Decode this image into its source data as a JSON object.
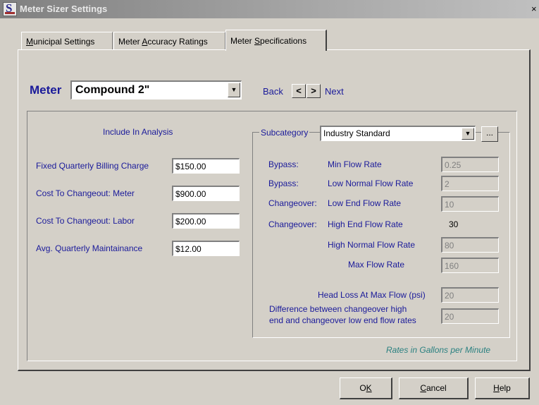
{
  "window": {
    "title": "Meter Sizer Settings",
    "close_glyph": "×"
  },
  "tabs": [
    {
      "label_pre": "",
      "label_u": "M",
      "label_post": "unicipal Settings",
      "active": false
    },
    {
      "label_pre": "Meter ",
      "label_u": "A",
      "label_post": "ccuracy Ratings",
      "active": false
    },
    {
      "label_pre": "Meter ",
      "label_u": "S",
      "label_post": "pecifications",
      "active": true
    }
  ],
  "meter": {
    "label": "Meter",
    "selected": "Compound 2\""
  },
  "navigation": {
    "back_label": "Back",
    "prev_glyph": "<",
    "next_glyph": ">",
    "next_label": "Next"
  },
  "analysis": {
    "heading": "Include In Analysis",
    "fields": [
      {
        "label": "Fixed Quarterly Billing Charge",
        "value": "$150.00"
      },
      {
        "label": "Cost To Changeout: Meter",
        "value": "$900.00"
      },
      {
        "label": "Cost To Changeout: Labor",
        "value": "$200.00"
      },
      {
        "label": "Avg. Quarterly Maintainance",
        "value": "$12.00"
      }
    ]
  },
  "subcategory": {
    "label": "Subcategory",
    "selected": "Industry Standard",
    "browse_label": "..."
  },
  "flow_rates": {
    "bypass_prefix": "Bypass:",
    "changeover_prefix": "Changeover:",
    "min_flow": {
      "label": "Min Flow Rate",
      "value": "0.25"
    },
    "low_normal_flow": {
      "label": "Low Normal Flow Rate",
      "value": "2"
    },
    "low_end_flow": {
      "label": "Low End Flow Rate",
      "value": "10"
    },
    "high_end_flow": {
      "label": "High End Flow Rate",
      "value": "30"
    },
    "high_normal_flow": {
      "label": "High Normal Flow Rate",
      "value": "80"
    },
    "max_flow": {
      "label": "Max Flow Rate",
      "value": "160"
    },
    "head_loss": {
      "label": "Head Loss At Max Flow (psi)",
      "value": "20"
    },
    "difference": {
      "label_line1": "Difference between changeover high",
      "label_line2": "end and changeover low end flow rates",
      "value": "20"
    }
  },
  "footnote": "Rates in Gallons per Minute",
  "buttons": {
    "ok": {
      "pre": "O",
      "u": "K",
      "post": ""
    },
    "cancel": {
      "pre": "",
      "u": "C",
      "post": "ancel"
    },
    "help": {
      "pre": "",
      "u": "H",
      "post": "elp"
    }
  }
}
